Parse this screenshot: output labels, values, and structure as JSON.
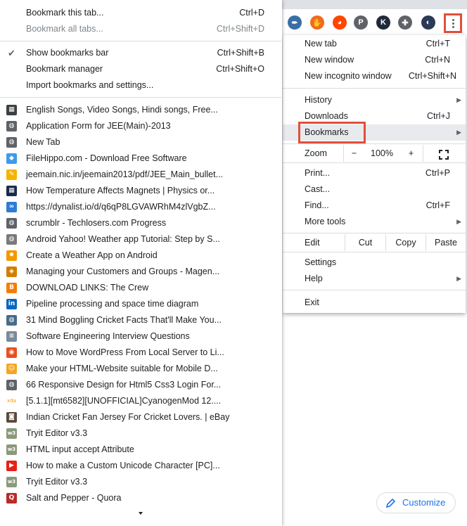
{
  "bookmarks_menu": {
    "top_items": [
      {
        "label": "Bookmark this tab...",
        "shortcut": "Ctrl+D",
        "disabled": false
      },
      {
        "label": "Bookmark all tabs...",
        "shortcut": "Ctrl+Shift+D",
        "disabled": true
      }
    ],
    "middle_items": [
      {
        "label": "Show bookmarks bar",
        "shortcut": "Ctrl+Shift+B",
        "checked": true
      },
      {
        "label": "Bookmark manager",
        "shortcut": "Ctrl+Shift+O",
        "checked": false
      },
      {
        "label": "Import bookmarks and settings...",
        "shortcut": "",
        "checked": false
      }
    ],
    "bookmarks": [
      {
        "title": "English Songs, Video Songs, Hindi songs, Free...",
        "icon": "site-icon-dark",
        "color": "#3c4043",
        "glyph": "▦"
      },
      {
        "title": "Application Form for JEE(Main)-2013",
        "icon": "globe-icon",
        "color": "#5f6368",
        "glyph": "◍"
      },
      {
        "title": "New Tab",
        "icon": "globe-icon",
        "color": "#5f6368",
        "glyph": "◍"
      },
      {
        "title": "FileHippo.com - Download Free Software",
        "icon": "hippo-icon",
        "color": "#3d9be9",
        "glyph": "◆"
      },
      {
        "title": "jeemain.nic.in/jeemain2013/pdf/JEE_Main_bullet...",
        "icon": "pencil-icon",
        "color": "#f4b400",
        "glyph": "✎"
      },
      {
        "title": "How Temperature Affects Magnets | Physics or...",
        "icon": "site-icon-dark",
        "color": "#1a2a4a",
        "glyph": "▦"
      },
      {
        "title": "https://dynalist.io/d/q6qP8LGVAWRhM4zlVgbZ...",
        "icon": "infinity-icon",
        "color": "#2d7dd2",
        "glyph": "∞"
      },
      {
        "title": "scrumblr - Techlosers.com Progress",
        "icon": "globe-icon",
        "color": "#5f6368",
        "glyph": "◍"
      },
      {
        "title": "Android Yahoo! Weather app Tutorial: Step by S...",
        "icon": "site-icon-globe",
        "color": "#7a7a7a",
        "glyph": "◍"
      },
      {
        "title": "Create a Weather App on Android",
        "icon": "sun-icon",
        "color": "#f29900",
        "glyph": "✹"
      },
      {
        "title": "Managing your Customers and Groups - Magen...",
        "icon": "magento-icon",
        "color": "#d17f00",
        "glyph": "◈"
      },
      {
        "title": "DOWNLOAD LINKS: The Crew",
        "icon": "blogger-icon",
        "color": "#f57d00",
        "glyph": "B"
      },
      {
        "title": "Pipeline processing and space time diagram",
        "icon": "linkedin-icon",
        "color": "#0a66c2",
        "glyph": "in"
      },
      {
        "title": "31 Mind Boggling Cricket Facts That'll Make You...",
        "icon": "site-icon-globe",
        "color": "#4a6b8a",
        "glyph": "◍"
      },
      {
        "title": "Software Engineering Interview Questions",
        "icon": "code-icon",
        "color": "#7a8a9a",
        "glyph": "≡"
      },
      {
        "title": "How to Move WordPress From Local Server to Li...",
        "icon": "owl-icon",
        "color": "#e8501f",
        "glyph": "◉"
      },
      {
        "title": "Make your HTML-Website suitable for Mobile D...",
        "icon": "person-icon",
        "color": "#f5a623",
        "glyph": "☺"
      },
      {
        "title": "66 Responsive Design for Html5 Css3 Login For...",
        "icon": "globe-icon",
        "color": "#5f6368",
        "glyph": "◍"
      },
      {
        "title": "[5.1.1][mt6582][UNOFFICIAL]CyanogenMod 12....",
        "icon": "xda-icon",
        "color": "#f29900",
        "glyph": "xda"
      },
      {
        "title": "Indian Cricket Fan Jersey For Cricket Lovers. | eBay",
        "icon": "bag-icon",
        "color": "#5a4a3a",
        "glyph": "◙"
      },
      {
        "title": "Tryit Editor v3.3",
        "icon": "w3-icon",
        "color": "#8a9a7a",
        "glyph": "w3"
      },
      {
        "title": "HTML input accept Attribute",
        "icon": "w3-icon",
        "color": "#8a9a7a",
        "glyph": "w3"
      },
      {
        "title": "How to make a Custom Unicode Character [PC]...",
        "icon": "youtube-icon",
        "color": "#e62117",
        "glyph": "▶"
      },
      {
        "title": "Tryit Editor v3.3",
        "icon": "w3-icon",
        "color": "#8a9a7a",
        "glyph": "w3"
      },
      {
        "title": "Salt and Pepper - Quora",
        "icon": "quora-icon",
        "color": "#b92b27",
        "glyph": "Q"
      }
    ]
  },
  "main_menu": {
    "new_tab": {
      "label": "New tab",
      "shortcut": "Ctrl+T"
    },
    "new_window": {
      "label": "New window",
      "shortcut": "Ctrl+N"
    },
    "incognito": {
      "label": "New incognito window",
      "shortcut": "Ctrl+Shift+N"
    },
    "history": {
      "label": "History"
    },
    "downloads": {
      "label": "Downloads",
      "shortcut": "Ctrl+J"
    },
    "bookmarks": {
      "label": "Bookmarks"
    },
    "zoom": {
      "label": "Zoom",
      "minus": "−",
      "value": "100%",
      "plus": "+"
    },
    "print": {
      "label": "Print...",
      "shortcut": "Ctrl+P"
    },
    "cast": {
      "label": "Cast..."
    },
    "find": {
      "label": "Find...",
      "shortcut": "Ctrl+F"
    },
    "more_tools": {
      "label": "More tools"
    },
    "edit": {
      "label": "Edit",
      "cut": "Cut",
      "copy": "Copy",
      "paste": "Paste"
    },
    "settings": {
      "label": "Settings"
    },
    "help": {
      "label": "Help"
    },
    "exit": {
      "label": "Exit"
    }
  },
  "toolbar": {
    "extensions": [
      {
        "name": "pen-extension-icon",
        "color": "#3a6ea5",
        "glyph": "✒"
      },
      {
        "name": "hand-extension-icon",
        "color": "#f26b1d",
        "glyph": "✋"
      },
      {
        "name": "reddit-extension-icon",
        "color": "#ff4500",
        "glyph": "◕"
      },
      {
        "name": "pinterest-extension-icon",
        "color": "#5f6368",
        "glyph": "P"
      },
      {
        "name": "k-extension-icon",
        "color": "#1e2a3a",
        "glyph": "K"
      },
      {
        "name": "puzzle-extension-icon",
        "color": "#5f6368",
        "glyph": "✚"
      },
      {
        "name": "profile-avatar",
        "color": "#2b3a55",
        "glyph": "◐"
      }
    ]
  },
  "customize": {
    "label": "Customize"
  },
  "colors": {
    "highlight": "#e0513a",
    "accent": "#1a73e8"
  }
}
